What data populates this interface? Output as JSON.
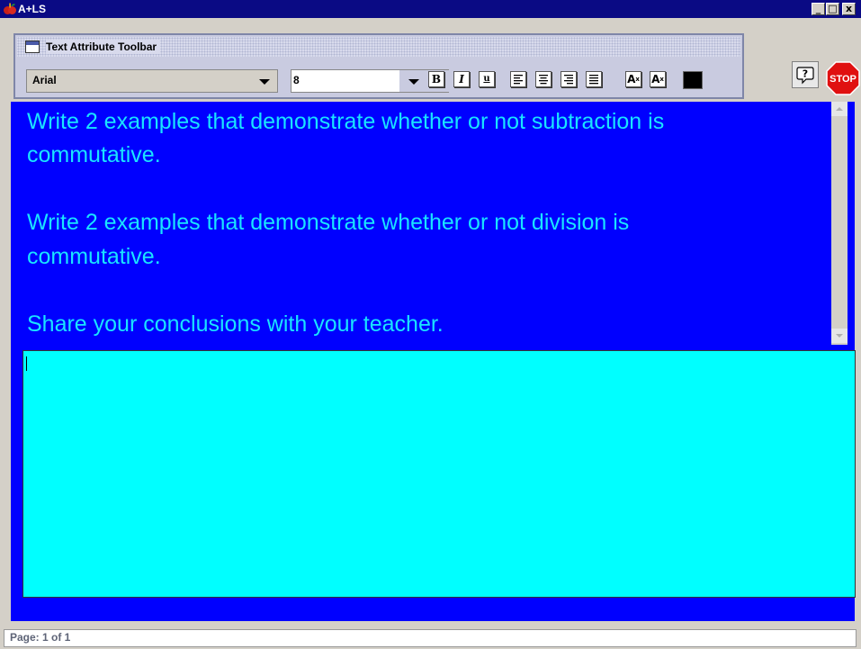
{
  "window": {
    "title": "A+LS",
    "icon": "apple-logo-icon",
    "controls": {
      "minimize": "_",
      "maximize": "□",
      "close": "x"
    }
  },
  "toolbar": {
    "title": "Text Attribute Toolbar",
    "font": "Arial",
    "size": "8",
    "bold_label": "B",
    "italic_label": "I",
    "underline_label": "u",
    "superscript_label": "A",
    "subscript_label": "A",
    "color": "#000000"
  },
  "buttons": {
    "help_label": "?",
    "stop_label": "STOP"
  },
  "question": {
    "lines": [
      "Write 2 examples that demonstrate whether or not subtraction is",
      "commutative.",
      "Write 2 examples that demonstrate whether or not division is",
      "commutative.",
      "Share your conclusions with your teacher."
    ]
  },
  "answer": {
    "value": ""
  },
  "status": {
    "page": "Page: 1 of 1"
  },
  "colors": {
    "content_bg": "#0000ff",
    "question_text": "#19e4ff",
    "answer_bg": "#00ffff",
    "title_bar": "#0a0a84",
    "stop_red": "#e01010"
  }
}
